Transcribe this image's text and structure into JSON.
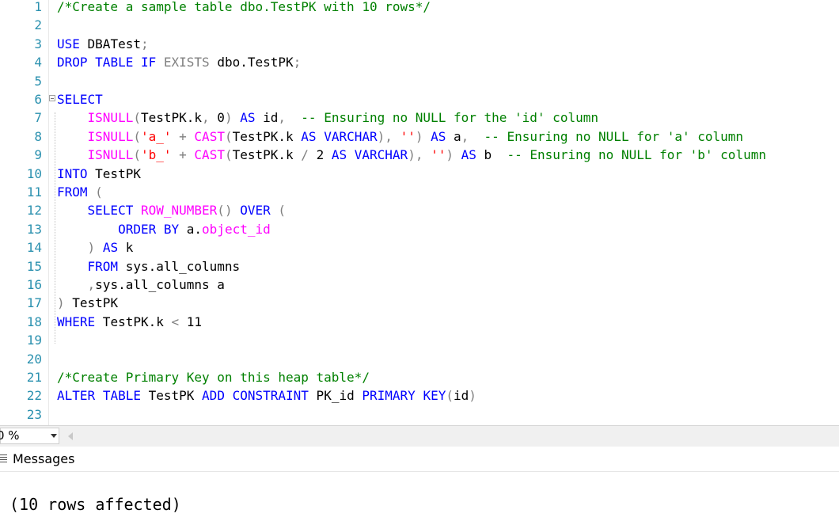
{
  "editor": {
    "line_numbers": [
      "1",
      "2",
      "3",
      "4",
      "5",
      "6",
      "7",
      "8",
      "9",
      "10",
      "11",
      "12",
      "13",
      "14",
      "15",
      "16",
      "17",
      "18",
      "19",
      "20",
      "21",
      "22",
      "23"
    ],
    "lines": [
      "/*Create a sample table dbo.TestPK with 10 rows*/",
      "",
      "USE DBATest;",
      "DROP TABLE IF EXISTS dbo.TestPK;",
      "",
      "SELECT",
      "    ISNULL(TestPK.k, 0) AS id,  -- Ensuring no NULL for the 'id' column",
      "    ISNULL('a_' + CAST(TestPK.k AS VARCHAR), '') AS a,  -- Ensuring no NULL for 'a' column",
      "    ISNULL('b_' + CAST(TestPK.k / 2 AS VARCHAR), '') AS b  -- Ensuring no NULL for 'b' column",
      "INTO TestPK",
      "FROM (",
      "    SELECT ROW_NUMBER() OVER (",
      "        ORDER BY a.object_id",
      "    ) AS k",
      "    FROM sys.all_columns",
      "    ,sys.all_columns a",
      ") TestPK",
      "WHERE TestPK.k < 11",
      "",
      "",
      "/*Create Primary Key on this heap table*/",
      "ALTER TABLE TestPK ADD CONSTRAINT PK_id PRIMARY KEY(id)",
      ""
    ]
  },
  "zoom": {
    "value": "0 %"
  },
  "results_tabs": {
    "messages_label": "Messages"
  },
  "output": {
    "message": "(10 rows affected)"
  },
  "colors": {
    "keyword": "#0000ff",
    "function": "#ff00ff",
    "string": "#ff0000",
    "comment": "#008000",
    "operator": "#808080",
    "line_number": "#2b91af"
  }
}
